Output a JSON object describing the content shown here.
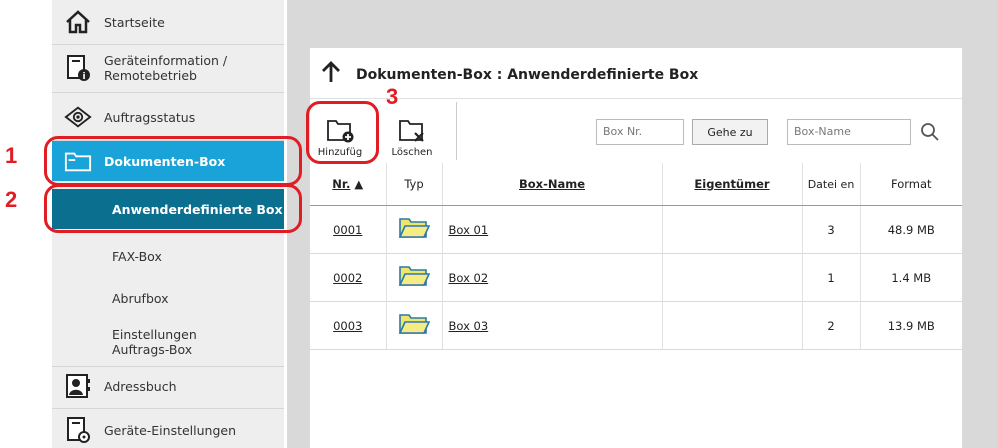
{
  "sidebar": {
    "items": [
      {
        "label": "Startseite",
        "icon": "home-icon"
      },
      {
        "label": "Geräteinformation / Remotebetrieb",
        "icon": "device-info-icon"
      },
      {
        "label": "Auftragsstatus",
        "icon": "eye-icon"
      },
      {
        "label": "Dokumenten-Box",
        "icon": "folder-icon"
      },
      {
        "label": "Anwenderdefinierte Box"
      },
      {
        "label": "FAX-Box"
      },
      {
        "label": "Abrufbox"
      },
      {
        "label": "Einstellungen Auftrags-Box"
      },
      {
        "label": "Adressbuch",
        "icon": "address-book-icon"
      },
      {
        "label": "Geräte-Einstellungen",
        "icon": "device-settings-icon"
      }
    ]
  },
  "main": {
    "title": "Dokumenten-Box : Anwenderdefinierte Box",
    "toolbar": {
      "add_label": "Hinzufüg",
      "delete_label": "Löschen",
      "box_nr_placeholder": "Box Nr.",
      "goto_label": "Gehe zu",
      "box_name_placeholder": "Box-Name"
    },
    "table": {
      "headers": {
        "nr": "Nr.",
        "type": "Typ",
        "name": "Box-Name",
        "owner": "Eigentümer",
        "files": "Datei en",
        "format": "Format"
      },
      "rows": [
        {
          "nr": "0001",
          "name": "Box 01",
          "owner": "",
          "files": "3",
          "format": "48.9 MB"
        },
        {
          "nr": "0002",
          "name": "Box 02",
          "owner": "",
          "files": "1",
          "format": "1.4 MB"
        },
        {
          "nr": "0003",
          "name": "Box 03",
          "owner": "",
          "files": "2",
          "format": "13.9 MB"
        }
      ]
    }
  },
  "annotations": {
    "n1": "1",
    "n2": "2",
    "n3": "3"
  },
  "colors": {
    "accent": "#1aa3d8",
    "accent_dark": "#0b6f8f",
    "callout": "#e11d24"
  }
}
